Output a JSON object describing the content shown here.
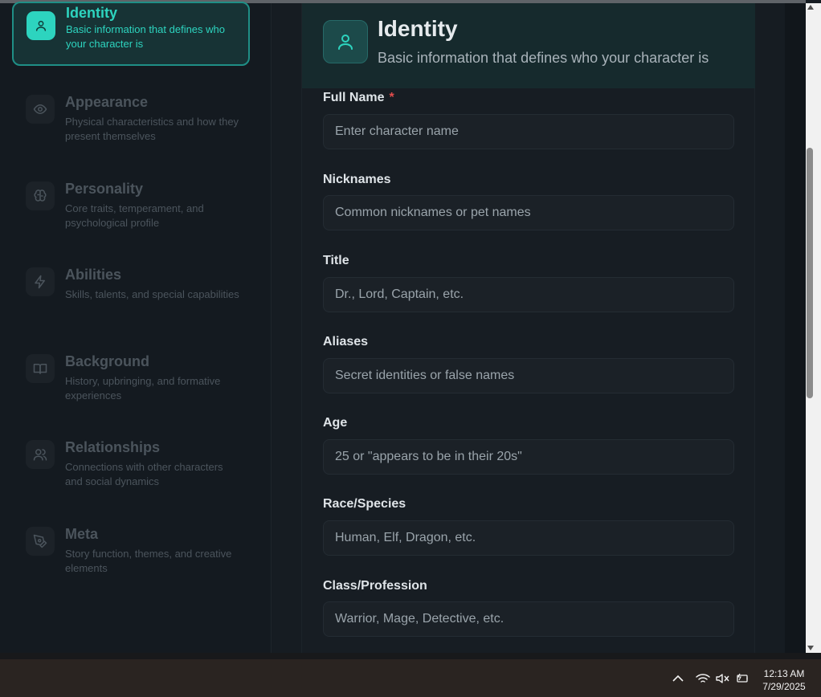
{
  "sidebar": {
    "items": [
      {
        "title": "Identity",
        "desc": "Basic information that defines who your character is",
        "icon": "user-icon",
        "active": true
      },
      {
        "title": "Appearance",
        "desc": "Physical characteristics and how they present themselves",
        "icon": "eye-icon"
      },
      {
        "title": "Personality",
        "desc": "Core traits, temperament, and psychological profile",
        "icon": "brain-icon"
      },
      {
        "title": "Abilities",
        "desc": "Skills, talents, and special capabilities",
        "icon": "lightning-icon"
      },
      {
        "title": "Background",
        "desc": "History, upbringing, and formative experiences",
        "icon": "book-icon"
      },
      {
        "title": "Relationships",
        "desc": "Connections with other characters and social dynamics",
        "icon": "users-icon"
      },
      {
        "title": "Meta",
        "desc": "Story function, themes, and creative elements",
        "icon": "pen-tool-icon"
      }
    ]
  },
  "header": {
    "title": "Identity",
    "subtitle": "Basic information that defines who your character is",
    "icon": "user-icon"
  },
  "fields": [
    {
      "label": "Full Name",
      "required": "*",
      "placeholder": "Enter character name"
    },
    {
      "label": "Nicknames",
      "placeholder": "Common nicknames or pet names"
    },
    {
      "label": "Title",
      "placeholder": "Dr., Lord, Captain, etc."
    },
    {
      "label": "Aliases",
      "placeholder": "Secret identities or false names"
    },
    {
      "label": "Age",
      "placeholder": "25 or \"appears to be in their 20s\""
    },
    {
      "label": "Race/Species",
      "placeholder": "Human, Elf, Dragon, etc."
    },
    {
      "label": "Class/Profession",
      "placeholder": "Warrior, Mage, Detective, etc."
    }
  ],
  "taskbar": {
    "time": "12:13 AM",
    "date": "7/29/2025",
    "tray_icons": [
      "chevron-up-icon",
      "wifi-icon",
      "volume-muted-icon",
      "battery-icon"
    ]
  },
  "colors": {
    "accent": "#2dd4bf",
    "background": "#151b21",
    "required": "#e24c4c"
  }
}
